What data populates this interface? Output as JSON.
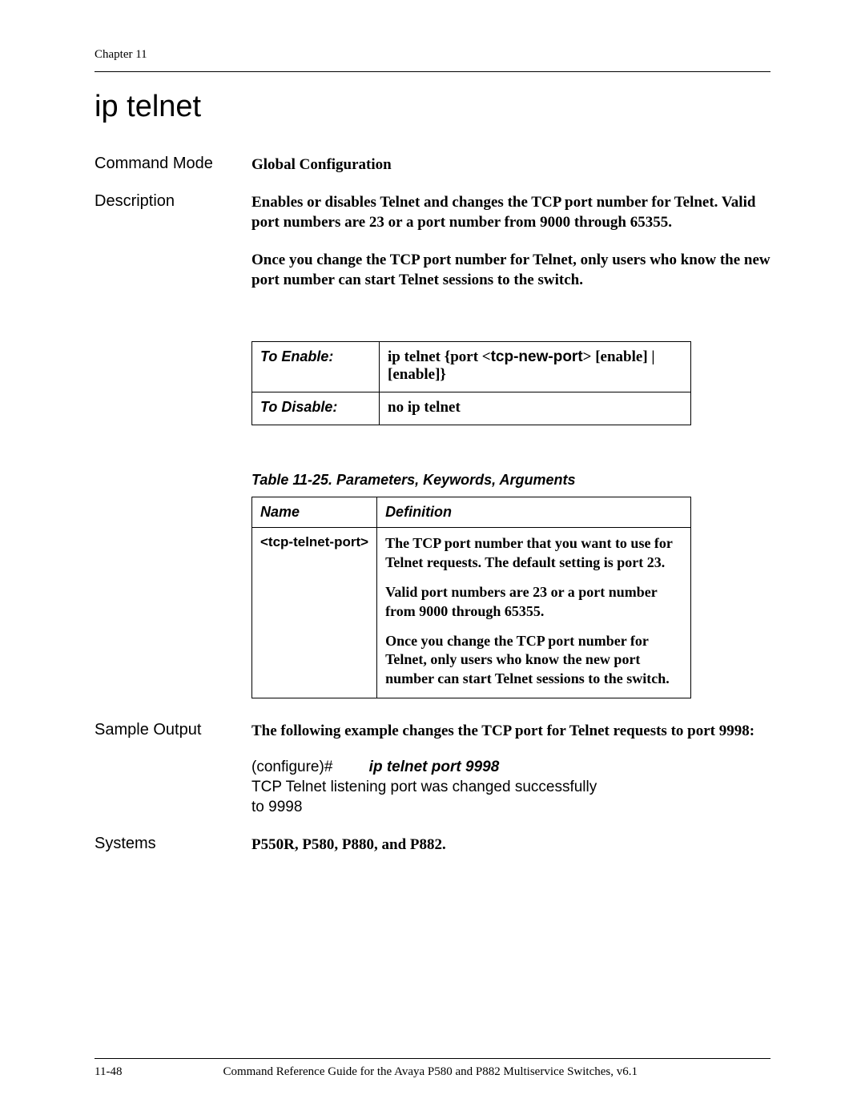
{
  "header": {
    "chapter": "Chapter 11"
  },
  "title": "ip telnet",
  "rows": {
    "command_mode": {
      "label": "Command Mode",
      "value": "Global Configuration"
    },
    "description": {
      "label": "Description",
      "p1": "Enables or disables Telnet and changes the TCP port number for Telnet. Valid port numbers are 23 or a port number from 9000 through 65355.",
      "p2": "Once you change the TCP port number for Telnet, only users who know the new port number can start Telnet sessions to the switch."
    },
    "sample_output": {
      "label": "Sample Output",
      "intro": "The following example changes the TCP port for Telnet requests to port 9998:",
      "cli_prompt": "(configure)#",
      "cli_cmd": "ip telnet port 9998",
      "cli_response1": "TCP Telnet listening port was changed successfully",
      "cli_response2": "to 9998"
    },
    "systems": {
      "label": "Systems",
      "value": "P550R, P580, P880, and P882."
    }
  },
  "enable_table": {
    "enable_label": "To Enable:",
    "enable_value_prefix": "ip telnet {port <",
    "enable_value_bold": "tcp-new-port",
    "enable_value_suffix": "> [enable] | [enable]}",
    "disable_label": "To Disable:",
    "disable_value": "no ip telnet"
  },
  "param_table": {
    "caption": "Table 11-25.  Parameters, Keywords, Arguments",
    "headers": {
      "name": "Name",
      "definition": "Definition"
    },
    "row": {
      "name": "<tcp-telnet-port>",
      "def_p1": "The TCP port number that you want to use for Telnet requests. The default setting is port 23.",
      "def_p2": "Valid port numbers are 23 or a port number from 9000 through 65355.",
      "def_p3": "Once you change the TCP port number for Telnet, only users who know the new port number can start Telnet sessions to the switch."
    }
  },
  "footer": {
    "page_num": "11-48",
    "center": "Command Reference Guide for the Avaya P580 and P882 Multiservice Switches, v6.1"
  }
}
